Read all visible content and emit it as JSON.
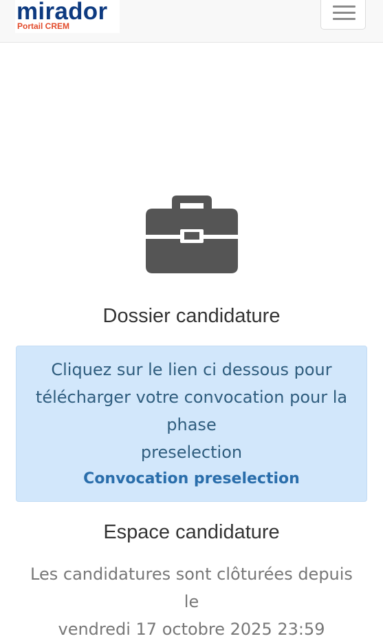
{
  "navbar": {
    "brand_name": "mirador",
    "brand_subtitle": "Portail CREM",
    "menu_icon": "hamburger-menu-icon"
  },
  "dossier": {
    "icon": "briefcase-icon",
    "title": "Dossier candidature",
    "message_line1": "Cliquez sur le lien ci dessous pour",
    "message_line2": "télécharger votre convocation pour la phase",
    "message_line3": "preselection",
    "link_label": "Convocation preselection"
  },
  "espace": {
    "title": "Espace candidature",
    "closed_line1": "Les candidatures sont clôturées depuis le",
    "closed_line2": "vendredi 17 octobre 2025 23:59"
  },
  "colors": {
    "brand": "#0d3a80",
    "brand_subtitle": "#e24a2a",
    "info_background": "#d2e7fb",
    "link": "#2a6eab",
    "icon": "#555555"
  }
}
